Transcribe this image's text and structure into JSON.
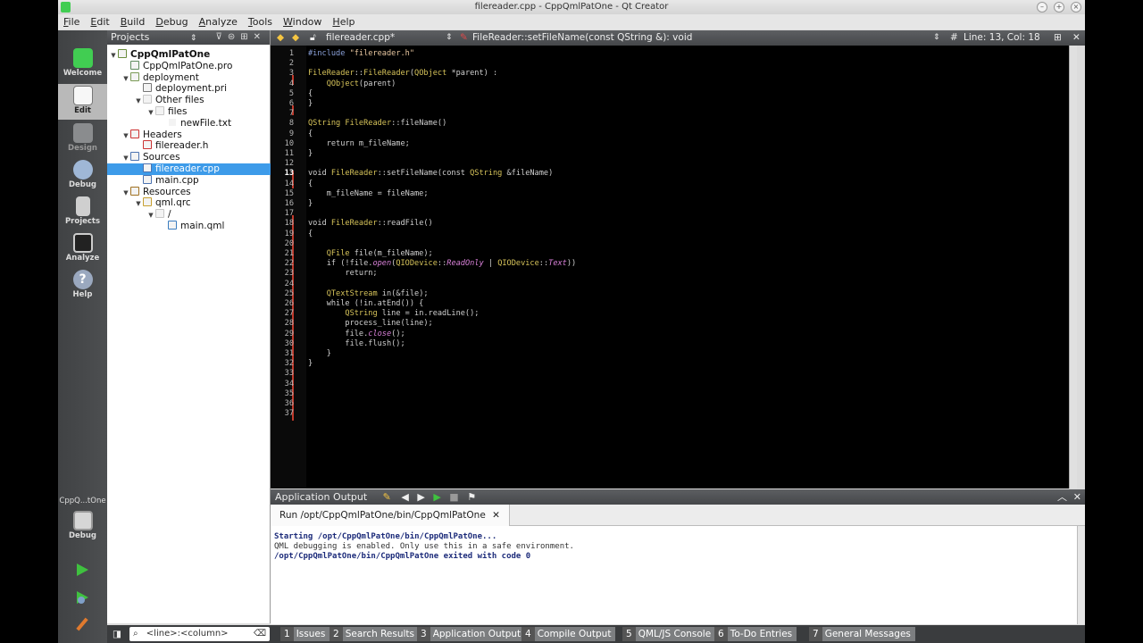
{
  "window": {
    "title": "filereader.cpp - CppQmlPatOne - Qt Creator"
  },
  "menu": [
    "File",
    "Edit",
    "Build",
    "Debug",
    "Analyze",
    "Tools",
    "Window",
    "Help"
  ],
  "modes": [
    {
      "label": "Welcome",
      "icon": "qt-logo-icon"
    },
    {
      "label": "Edit",
      "icon": "edit-document-icon"
    },
    {
      "label": "Design",
      "icon": "design-icon"
    },
    {
      "label": "Debug",
      "icon": "debug-icon"
    },
    {
      "label": "Projects",
      "icon": "projects-icon"
    },
    {
      "label": "Analyze",
      "icon": "analyze-icon"
    },
    {
      "label": "Help",
      "icon": "help-icon"
    }
  ],
  "target": {
    "project_short": "CppQ...tOne",
    "build_label": "Debug"
  },
  "projects_pane": {
    "title": "Projects",
    "tree": [
      {
        "label": "CppQmlPatOne",
        "depth": 0,
        "arrow": "down",
        "bold": true
      },
      {
        "label": "CppQmlPatOne.pro",
        "depth": 1,
        "arrow": ""
      },
      {
        "label": "deployment",
        "depth": 1,
        "arrow": "down"
      },
      {
        "label": "deployment.pri",
        "depth": 2,
        "arrow": ""
      },
      {
        "label": "Other files",
        "depth": 2,
        "arrow": "down"
      },
      {
        "label": "files",
        "depth": 3,
        "arrow": "down"
      },
      {
        "label": "newFile.txt",
        "depth": 4,
        "arrow": ""
      },
      {
        "label": "Headers",
        "depth": 1,
        "arrow": "down"
      },
      {
        "label": "filereader.h",
        "depth": 2,
        "arrow": ""
      },
      {
        "label": "Sources",
        "depth": 1,
        "arrow": "down"
      },
      {
        "label": "filereader.cpp",
        "depth": 2,
        "arrow": "",
        "selected": true
      },
      {
        "label": "main.cpp",
        "depth": 2,
        "arrow": ""
      },
      {
        "label": "Resources",
        "depth": 1,
        "arrow": "down"
      },
      {
        "label": "qml.qrc",
        "depth": 2,
        "arrow": "down"
      },
      {
        "label": "/",
        "depth": 3,
        "arrow": "down"
      },
      {
        "label": "main.qml",
        "depth": 4,
        "arrow": ""
      }
    ]
  },
  "editor": {
    "file_tab": "filereader.cpp*",
    "symbol": "FileReader::setFileName(const QString &): void",
    "position": "Line: 13, Col: 18",
    "line_count": 37,
    "current_line": 13,
    "lines": [
      "#include \"filereader.h\"",
      "",
      "FileReader::FileReader(QObject *parent) :",
      "    QObject(parent)",
      "{",
      "}",
      "",
      "QString FileReader::fileName()",
      "{",
      "    return m_fileName;",
      "}",
      "",
      "void FileReader::setFileName(const QString &fileName)",
      "{",
      "    m_fileName = fileName;",
      "}",
      "",
      "void FileReader::readFile()",
      "{",
      "",
      "    QFile file(m_fileName);",
      "    if (!file.open(QIODevice::ReadOnly | QIODevice::Text))",
      "        return;",
      "",
      "    QTextStream in(&file);",
      "    while (!in.atEnd()) {",
      "        QString line = in.readLine();",
      "        process_line(line);",
      "        file.close();",
      "        file.flush();",
      "    }",
      "}",
      "",
      "",
      "",
      "",
      ""
    ]
  },
  "output": {
    "title": "Application Output",
    "tab": "Run /opt/CppQmlPatOne/bin/CppQmlPatOne",
    "lines": [
      {
        "text": "Starting /opt/CppQmlPatOne/bin/CppQmlPatOne...",
        "style": "b"
      },
      {
        "text": "QML debugging is enabled. Only use this in a safe environment.",
        "style": "g"
      },
      {
        "text": "/opt/CppQmlPatOne/bin/CppQmlPatOne exited with code 0",
        "style": "b"
      }
    ]
  },
  "statusbar": {
    "locator_placeholder": "<line>:<column>",
    "panes": [
      {
        "n": "1",
        "label": "Issues"
      },
      {
        "n": "2",
        "label": "Search Results"
      },
      {
        "n": "3",
        "label": "Application Output"
      },
      {
        "n": "4",
        "label": "Compile Output"
      },
      {
        "n": "5",
        "label": "QML/JS Console"
      },
      {
        "n": "6",
        "label": "To-Do Entries"
      },
      {
        "n": "7",
        "label": "General Messages"
      }
    ]
  },
  "colors": {
    "accent": "#3d9be9",
    "qt_green": "#41cd52",
    "modified_marker": "#c0392b"
  }
}
